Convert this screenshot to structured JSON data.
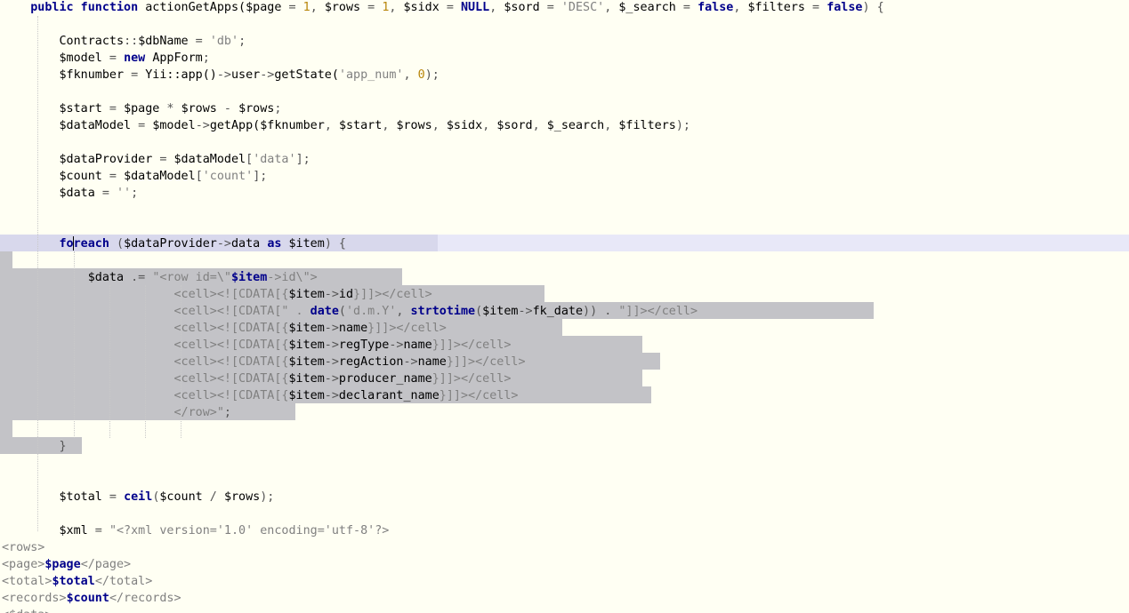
{
  "editor": {
    "lines": [
      [
        [
          "kw",
          "    public function "
        ],
        [
          "fn",
          "actionGetApps("
        ],
        [
          "var",
          "$page"
        ],
        [
          "op",
          " = "
        ],
        [
          "num",
          "1"
        ],
        [
          "op",
          ", "
        ],
        [
          "var",
          "$rows"
        ],
        [
          "op",
          " = "
        ],
        [
          "num",
          "1"
        ],
        [
          "op",
          ", "
        ],
        [
          "var",
          "$sidx"
        ],
        [
          "op",
          " = "
        ],
        [
          "kw",
          "NULL"
        ],
        [
          "op",
          ", "
        ],
        [
          "var",
          "$sord"
        ],
        [
          "op",
          " = "
        ],
        [
          "str",
          "'DESC'"
        ],
        [
          "op",
          ", "
        ],
        [
          "var",
          "$_search"
        ],
        [
          "op",
          " = "
        ],
        [
          "kw",
          "false"
        ],
        [
          "op",
          ", "
        ],
        [
          "var",
          "$filters"
        ],
        [
          "op",
          " = "
        ],
        [
          "kw",
          "false"
        ],
        [
          "op",
          ") {"
        ]
      ],
      [],
      [
        [
          "fn",
          "        Contracts"
        ],
        [
          "op",
          "::"
        ],
        [
          "var",
          "$dbName"
        ],
        [
          "op",
          " = "
        ],
        [
          "str",
          "'db'"
        ],
        [
          "op",
          ";"
        ]
      ],
      [
        [
          "var",
          "        $model"
        ],
        [
          "op",
          " = "
        ],
        [
          "kw",
          "new "
        ],
        [
          "fn",
          "AppForm"
        ],
        [
          "op",
          ";"
        ]
      ],
      [
        [
          "var",
          "        $fknumber"
        ],
        [
          "op",
          " = "
        ],
        [
          "fn",
          "Yii::app()"
        ],
        [
          "op",
          "->"
        ],
        [
          "fn",
          "user"
        ],
        [
          "op",
          "->"
        ],
        [
          "fn",
          "getState("
        ],
        [
          "str",
          "'app_num'"
        ],
        [
          "op",
          ", "
        ],
        [
          "num",
          "0"
        ],
        [
          "op",
          ");"
        ]
      ],
      [],
      [
        [
          "var",
          "        $start"
        ],
        [
          "op",
          " = "
        ],
        [
          "var",
          "$page"
        ],
        [
          "op",
          " * "
        ],
        [
          "var",
          "$rows"
        ],
        [
          "op",
          " - "
        ],
        [
          "var",
          "$rows"
        ],
        [
          "op",
          ";"
        ]
      ],
      [
        [
          "var",
          "        $dataModel"
        ],
        [
          "op",
          " = "
        ],
        [
          "var",
          "$model"
        ],
        [
          "op",
          "->"
        ],
        [
          "fn",
          "getApp("
        ],
        [
          "var",
          "$fknumber"
        ],
        [
          "op",
          ", "
        ],
        [
          "var",
          "$start"
        ],
        [
          "op",
          ", "
        ],
        [
          "var",
          "$rows"
        ],
        [
          "op",
          ", "
        ],
        [
          "var",
          "$sidx"
        ],
        [
          "op",
          ", "
        ],
        [
          "var",
          "$sord"
        ],
        [
          "op",
          ", "
        ],
        [
          "var",
          "$_search"
        ],
        [
          "op",
          ", "
        ],
        [
          "var",
          "$filters"
        ],
        [
          "op",
          ");"
        ]
      ],
      [],
      [
        [
          "var",
          "        $dataProvider"
        ],
        [
          "op",
          " = "
        ],
        [
          "var",
          "$dataModel"
        ],
        [
          "op",
          "["
        ],
        [
          "str",
          "'data'"
        ],
        [
          "op",
          "];"
        ]
      ],
      [
        [
          "var",
          "        $count"
        ],
        [
          "op",
          " = "
        ],
        [
          "var",
          "$dataModel"
        ],
        [
          "op",
          "["
        ],
        [
          "str",
          "'count'"
        ],
        [
          "op",
          "];"
        ]
      ],
      [
        [
          "var",
          "        $data"
        ],
        [
          "op",
          " = "
        ],
        [
          "str",
          "''"
        ],
        [
          "op",
          ";"
        ]
      ],
      [],
      [],
      [
        [
          "kw",
          "        foreach"
        ],
        [
          "op",
          " ("
        ],
        [
          "var",
          "$dataProvider"
        ],
        [
          "op",
          "->"
        ],
        [
          "fn",
          "data "
        ],
        [
          "kw",
          "as"
        ],
        [
          "op",
          " "
        ],
        [
          "var",
          "$item"
        ],
        [
          "op",
          ") {"
        ]
      ],
      [],
      [
        [
          "var",
          "            $data"
        ],
        [
          "op",
          " .= "
        ],
        [
          "str",
          "\"<row id=\\\""
        ],
        [
          "kw",
          "$item"
        ],
        [
          "str",
          "->id\\\">"
        ]
      ],
      [
        [
          "str",
          "                        <cell><![CDATA[{"
        ],
        [
          "var",
          "$item"
        ],
        [
          "op",
          "->"
        ],
        [
          "fn",
          "id"
        ],
        [
          "str",
          "}]]></cell>"
        ]
      ],
      [
        [
          "str",
          "                        <cell><![CDATA[\" . "
        ],
        [
          "bfn",
          "date"
        ],
        [
          "op",
          "("
        ],
        [
          "str",
          "'d.m.Y'"
        ],
        [
          "op",
          ", "
        ],
        [
          "bfn",
          "strtotime"
        ],
        [
          "op",
          "("
        ],
        [
          "var",
          "$item"
        ],
        [
          "op",
          "->"
        ],
        [
          "fn",
          "fk_date"
        ],
        [
          "op",
          ")) . "
        ],
        [
          "str",
          "\"]]></cell>"
        ]
      ],
      [
        [
          "str",
          "                        <cell><![CDATA[{"
        ],
        [
          "var",
          "$item"
        ],
        [
          "op",
          "->"
        ],
        [
          "fn",
          "name"
        ],
        [
          "str",
          "}]]></cell>"
        ]
      ],
      [
        [
          "str",
          "                        <cell><![CDATA[{"
        ],
        [
          "var",
          "$item"
        ],
        [
          "op",
          "->"
        ],
        [
          "fn",
          "regType"
        ],
        [
          "op",
          "->"
        ],
        [
          "fn",
          "name"
        ],
        [
          "str",
          "}]]></cell>"
        ]
      ],
      [
        [
          "str",
          "                        <cell><![CDATA[{"
        ],
        [
          "var",
          "$item"
        ],
        [
          "op",
          "->"
        ],
        [
          "fn",
          "regAction"
        ],
        [
          "op",
          "->"
        ],
        [
          "fn",
          "name"
        ],
        [
          "str",
          "}]]></cell>"
        ]
      ],
      [
        [
          "str",
          "                        <cell><![CDATA[{"
        ],
        [
          "var",
          "$item"
        ],
        [
          "op",
          "->"
        ],
        [
          "fn",
          "producer_name"
        ],
        [
          "str",
          "}]]></cell>"
        ]
      ],
      [
        [
          "str",
          "                        <cell><![CDATA[{"
        ],
        [
          "var",
          "$item"
        ],
        [
          "op",
          "->"
        ],
        [
          "fn",
          "declarant_name"
        ],
        [
          "str",
          "}]]></cell>"
        ]
      ],
      [
        [
          "str",
          "                        </row>\""
        ],
        [
          "op",
          ";"
        ]
      ],
      [],
      [
        [
          "op",
          "        }"
        ]
      ],
      [],
      [],
      [
        [
          "var",
          "        $total"
        ],
        [
          "op",
          " = "
        ],
        [
          "bfn",
          "ceil"
        ],
        [
          "op",
          "("
        ],
        [
          "var",
          "$count"
        ],
        [
          "op",
          " / "
        ],
        [
          "var",
          "$rows"
        ],
        [
          "op",
          ");"
        ]
      ],
      [],
      [
        [
          "var",
          "        $xml"
        ],
        [
          "op",
          " = "
        ],
        [
          "str",
          "\"<?xml version='1.0' encoding='utf-8'?>"
        ]
      ],
      [
        [
          "str",
          "<rows>"
        ]
      ],
      [
        [
          "str",
          "<page>"
        ],
        [
          "kw",
          "$page"
        ],
        [
          "str",
          "</page>"
        ]
      ],
      [
        [
          "str",
          "<total>"
        ],
        [
          "kw",
          "$total"
        ],
        [
          "str",
          "</total>"
        ]
      ],
      [
        [
          "str",
          "<records>"
        ],
        [
          "kw",
          "$count"
        ],
        [
          "str",
          "</records>"
        ]
      ],
      [
        [
          "str",
          "<$data>"
        ]
      ]
    ]
  }
}
